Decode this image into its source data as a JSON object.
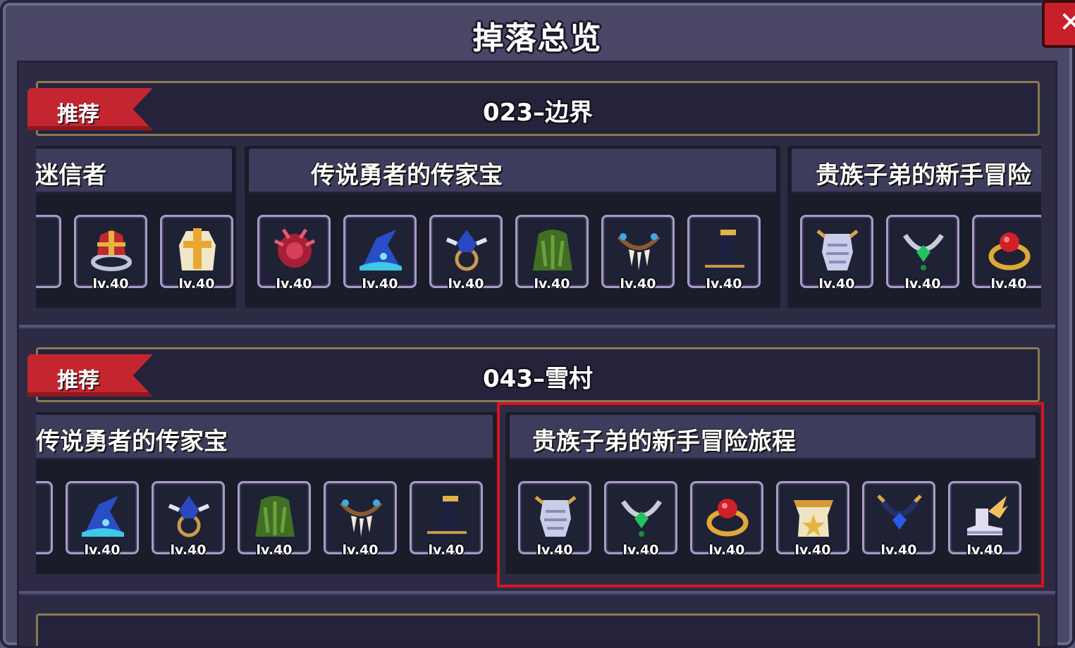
{
  "window": {
    "title": "掉落总览",
    "close_label": "×"
  },
  "sections": [
    {
      "tag": "推荐",
      "title": "023–边界",
      "sets": [
        {
          "name": "迷信者",
          "items": [
            {
              "icon": "crown-ring-icon",
              "level": "lv.40"
            },
            {
              "icon": "gold-cross-armor-icon",
              "level": "lv.40"
            }
          ]
        },
        {
          "name": "传说勇者的传家宝",
          "items": [
            {
              "icon": "red-flower-helm-icon",
              "level": "lv.40"
            },
            {
              "icon": "blue-wizard-hat-icon",
              "level": "lv.40"
            },
            {
              "icon": "blue-amulet-icon",
              "level": "lv.40"
            },
            {
              "icon": "green-robe-icon",
              "level": "lv.40"
            },
            {
              "icon": "fang-necklace-icon",
              "level": "lv.40"
            },
            {
              "icon": "dark-boots-icon",
              "level": "lv.40"
            }
          ]
        },
        {
          "name": "贵族子弟的新手冒险",
          "items": [
            {
              "icon": "silver-armor-icon",
              "level": "lv.40"
            },
            {
              "icon": "emerald-necklace-icon",
              "level": "lv.40"
            },
            {
              "icon": "ruby-ring-icon",
              "level": "lv.40"
            }
          ]
        }
      ]
    },
    {
      "tag": "推荐",
      "title": "043–雪村",
      "sets": [
        {
          "name": "传说勇者的传家宝",
          "items": [
            {
              "icon": "blue-wizard-hat-icon",
              "level": "lv.40"
            },
            {
              "icon": "blue-amulet-icon",
              "level": "lv.40"
            },
            {
              "icon": "green-robe-icon",
              "level": "lv.40"
            },
            {
              "icon": "fang-necklace-icon",
              "level": "lv.40"
            },
            {
              "icon": "dark-boots-icon",
              "level": "lv.40"
            }
          ]
        },
        {
          "name": "贵族子弟的新手冒险旅程",
          "items": [
            {
              "icon": "silver-armor-icon",
              "level": "lv.40"
            },
            {
              "icon": "emerald-necklace-icon",
              "level": "lv.40"
            },
            {
              "icon": "ruby-ring-icon",
              "level": "lv.40"
            },
            {
              "icon": "gold-plate-armor-icon",
              "level": "lv.40"
            },
            {
              "icon": "sapphire-necklace-icon",
              "level": "lv.40"
            },
            {
              "icon": "winged-boots-icon",
              "level": "lv.40"
            }
          ]
        }
      ]
    }
  ],
  "colors": {
    "highlight": "#d8141e",
    "ribbon": "#c42630",
    "banner_border": "#8a7a52"
  }
}
